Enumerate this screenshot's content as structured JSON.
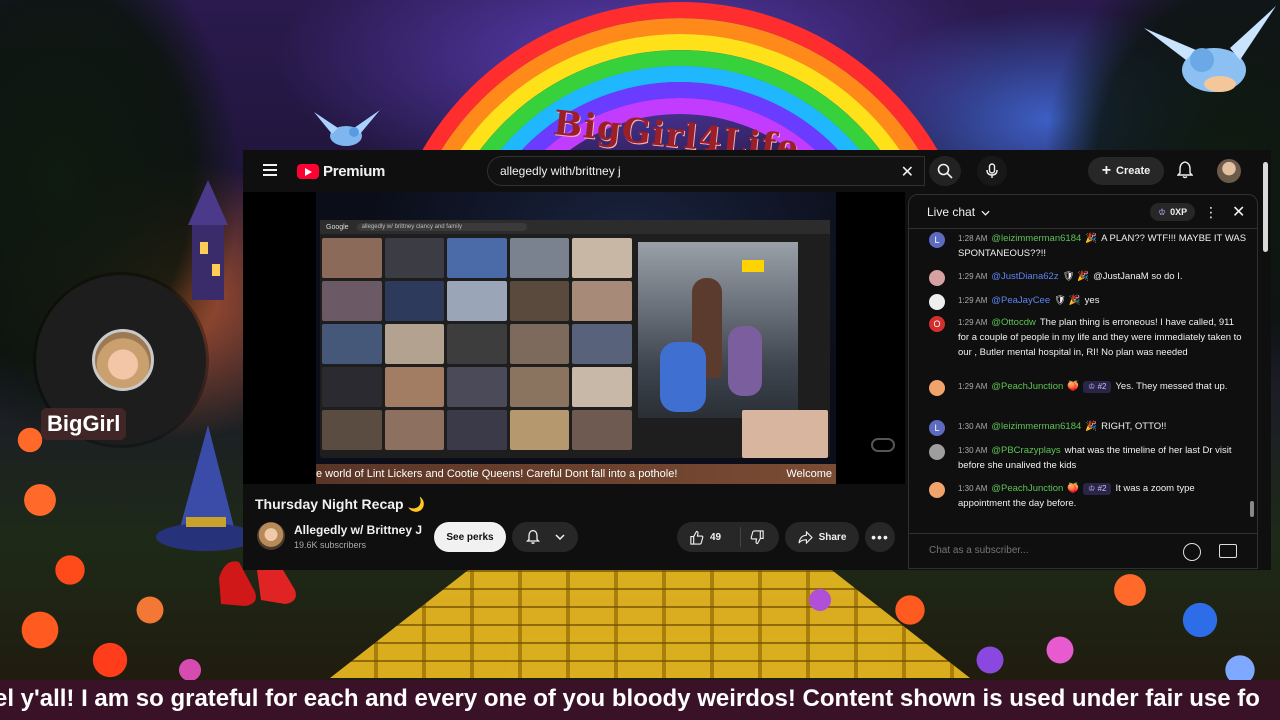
{
  "overlay": {
    "watermark": "BigGirl4Life",
    "streamer_name": "BigGirl",
    "bottom_ticker": "el y'all! I am so grateful for each and every one of you bloody weirdos! Content shown is used under fair use fo"
  },
  "youtube": {
    "logo_text": "Premium",
    "search": {
      "value": "allegedly with/brittney j"
    },
    "create_label": "Create",
    "colors": {
      "brand_red": "#ff0033",
      "bg": "#0f0f0f",
      "surface": "#272727"
    },
    "player": {
      "browser_tab": "Google",
      "browser_address": "allegedly w/ brittney clancy and family",
      "ticker_left": "e world of Lint Lickers and Cootie Queens!  Careful Dont fall into a pothole!",
      "ticker_right": "Welcome"
    },
    "video": {
      "title": "Thursday Night Recap 🌙",
      "channel_name": "Allegedly w/ Brittney J",
      "subscribers": "19.6K subscribers",
      "perks_label": "See perks",
      "likes": "49",
      "share_label": "Share"
    },
    "chat": {
      "header": "Live chat",
      "xp": "0XP",
      "input_placeholder": "Chat as a subscriber...",
      "messages": [
        {
          "initial": "L",
          "avatar_color": "#5c6bc0",
          "time": "1:28 AM",
          "author": "@leizimmerman6184",
          "badge": "🎉",
          "tag": "",
          "text": "A PLAN?? WTF!!! MAYBE IT WAS SPONTANEOUS??!!"
        },
        {
          "initial": "",
          "avatar_color": "#d5a1a1",
          "time": "1:29 AM",
          "author": "@JustDiana62z",
          "badge": "🛡 🎉",
          "tag": "",
          "text": "@JustJanaM so do I."
        },
        {
          "initial": "",
          "avatar_color": "#eeeeee",
          "time": "1:29 AM",
          "author": "@PeaJayCee",
          "badge": "🛡 🎉",
          "tag": "",
          "text": "yes"
        },
        {
          "initial": "O",
          "avatar_color": "#d32f2f",
          "time": "1:29 AM",
          "author": "@Ottocdw",
          "badge": "",
          "tag": "",
          "text": "The plan thing is erroneous! I have called, 911 for a couple of people in my life and they were immediately taken to our , Butler mental hospital in, RI! No plan was needed"
        },
        {
          "initial": "",
          "avatar_color": "#f0a36b",
          "time": "1:29 AM",
          "author": "@PeachJunction",
          "badge": "🍑",
          "tag": "♔ #2",
          "text": "Yes. They messed that up."
        },
        {
          "initial": "L",
          "avatar_color": "#5c6bc0",
          "time": "1:30 AM",
          "author": "@leizimmerman6184",
          "badge": "🎉",
          "tag": "",
          "text": "RIGHT, OTTO!!"
        },
        {
          "initial": "",
          "avatar_color": "#9e9e9e",
          "time": "1:30 AM",
          "author": "@PBCrazyplays",
          "badge": "",
          "tag": "",
          "text": "what was the timeline of her last Dr visit before she unalived the kids"
        },
        {
          "initial": "",
          "avatar_color": "#f0a36b",
          "time": "1:30 AM",
          "author": "@PeachJunction",
          "badge": "🍑",
          "tag": "♔ #2",
          "text": "It was a zoom type appointment the day before."
        }
      ]
    }
  }
}
